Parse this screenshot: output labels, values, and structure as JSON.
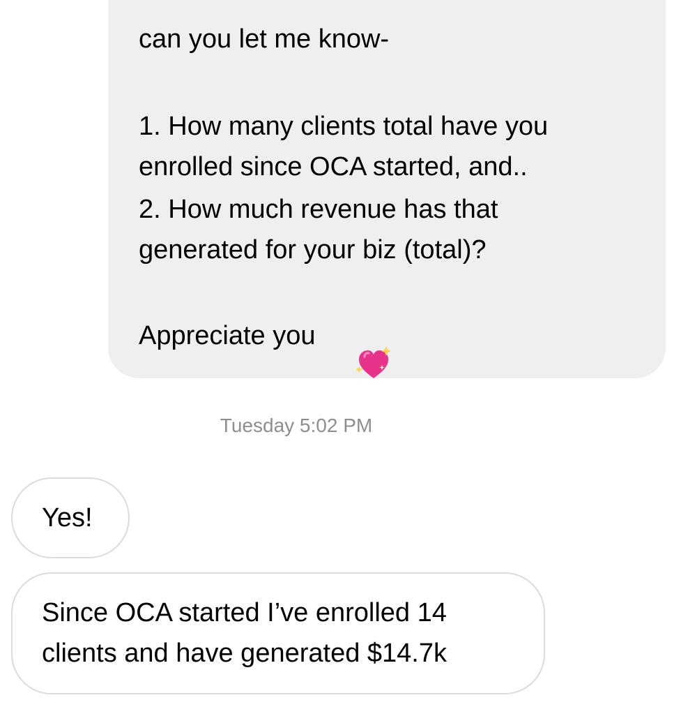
{
  "outgoing_message": {
    "lines": [
      "can you let me know-",
      "1. How many clients total have you",
      "enrolled since OCA started, and..",
      "2. How much revenue has that",
      "generated for your biz (total)?",
      "Appreciate you"
    ],
    "emoji": "sparkling-heart"
  },
  "timestamp": "Tuesday 5:02 PM",
  "incoming_messages": [
    {
      "lines": [
        "Yes!"
      ]
    },
    {
      "lines": [
        "Since OCA started I’ve enrolled 14",
        "clients and have generated $14.7k"
      ]
    }
  ],
  "colors": {
    "outgoing_bubble": "#efefef",
    "incoming_border": "#dbdbdb",
    "timestamp_text": "#8e8e8e",
    "heart_pink": "#e8338b"
  }
}
